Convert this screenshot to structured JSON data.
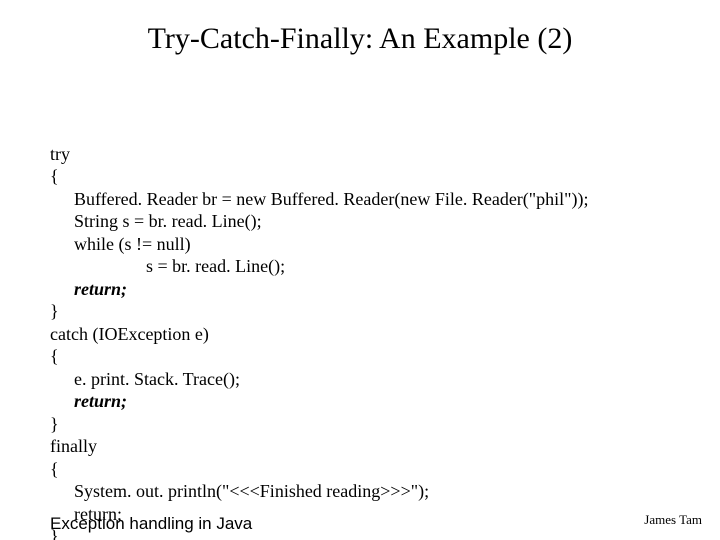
{
  "title": "Try-Catch-Finally: An Example (2)",
  "code": {
    "l1": "try",
    "l2": "{",
    "l3": "Buffered. Reader br = new Buffered. Reader(new File. Reader(\"phil\"));",
    "l4": "String s = br. read. Line();",
    "l5": "while (s != null)",
    "l6": "s = br. read. Line();",
    "l7": "return;",
    "l8": "}",
    "l9": "catch (IOException e)",
    "l10": "{",
    "l11": "e. print. Stack. Trace();",
    "l12": "return;",
    "l13": "}",
    "l14": "finally",
    "l15": "{",
    "l16": "System. out. println(\"<<<Finished reading>>>\");",
    "l17": "return;",
    "l18": "}"
  },
  "footer_left": "Exception handling in Java",
  "footer_right": "James Tam"
}
